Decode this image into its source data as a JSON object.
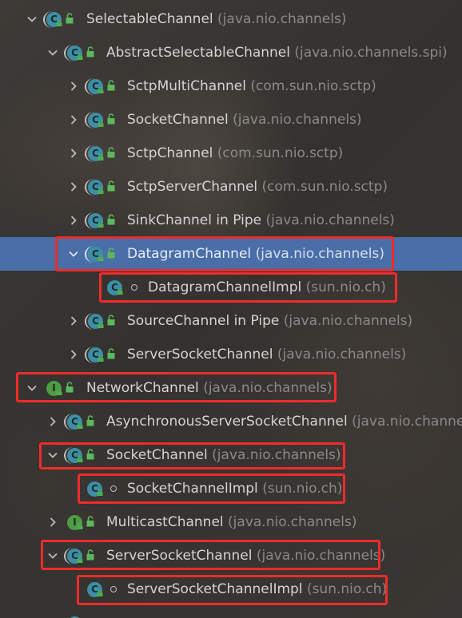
{
  "tree": {
    "rows": [
      {
        "name": "SelectableChannel",
        "pkg": "(java.nio.channels)",
        "kind": "class-abstract",
        "expanded": true
      },
      {
        "name": "AbstractSelectableChannel",
        "pkg": "(java.nio.channels.spi)",
        "kind": "class-abstract",
        "expanded": true
      },
      {
        "name": "SctpMultiChannel",
        "pkg": "(com.sun.nio.sctp)",
        "kind": "class-abstract",
        "expanded": false
      },
      {
        "name": "SocketChannel",
        "pkg": "(java.nio.channels)",
        "kind": "class-abstract",
        "expanded": false
      },
      {
        "name": "SctpChannel",
        "pkg": "(com.sun.nio.sctp)",
        "kind": "class-abstract",
        "expanded": false
      },
      {
        "name": "SctpServerChannel",
        "pkg": "(com.sun.nio.sctp)",
        "kind": "class-abstract",
        "expanded": false
      },
      {
        "name": "SinkChannel in Pipe",
        "pkg": "(java.nio.channels)",
        "kind": "class-abstract",
        "expanded": false
      },
      {
        "name": "DatagramChannel",
        "pkg": "(java.nio.channels)",
        "kind": "class-abstract",
        "expanded": true,
        "selected": true
      },
      {
        "name": "DatagramChannelImpl",
        "pkg": "(sun.nio.ch)",
        "kind": "class",
        "expanded": null
      },
      {
        "name": "SourceChannel in Pipe",
        "pkg": "(java.nio.channels)",
        "kind": "class-abstract",
        "expanded": false
      },
      {
        "name": "ServerSocketChannel",
        "pkg": "(java.nio.channels)",
        "kind": "class-abstract",
        "expanded": false
      },
      {
        "name": "NetworkChannel",
        "pkg": "(java.nio.channels)",
        "kind": "interface",
        "expanded": true
      },
      {
        "name": "AsynchronousServerSocketChannel",
        "pkg": "(java.nio.channe",
        "kind": "class-abstract",
        "expanded": false
      },
      {
        "name": "SocketChannel",
        "pkg": "(java.nio.channels)",
        "kind": "class-abstract",
        "expanded": true
      },
      {
        "name": "SocketChannelImpl",
        "pkg": "(sun.nio.ch)",
        "kind": "class",
        "expanded": null
      },
      {
        "name": "MulticastChannel",
        "pkg": "(java.nio.channels)",
        "kind": "interface",
        "expanded": false
      },
      {
        "name": "ServerSocketChannel",
        "pkg": "(java.nio.channels)",
        "kind": "class-abstract",
        "expanded": true
      },
      {
        "name": "ServerSocketChannelImpl",
        "pkg": "(sun.nio.ch)",
        "kind": "class",
        "expanded": null
      }
    ]
  },
  "icons": {
    "class": "class-icon",
    "interface": "interface-icon",
    "lock": "lock-icon",
    "unlock": "unlock-icon",
    "expand": "chevron-down-icon",
    "collapse": "chevron-right-icon"
  },
  "colors": {
    "selection": "#4a6ea8",
    "highlight": "#ef2b2b",
    "class_icon": "#3d8ea5",
    "interface_icon": "#4f9b46",
    "package_text": "#8a8a8a"
  }
}
